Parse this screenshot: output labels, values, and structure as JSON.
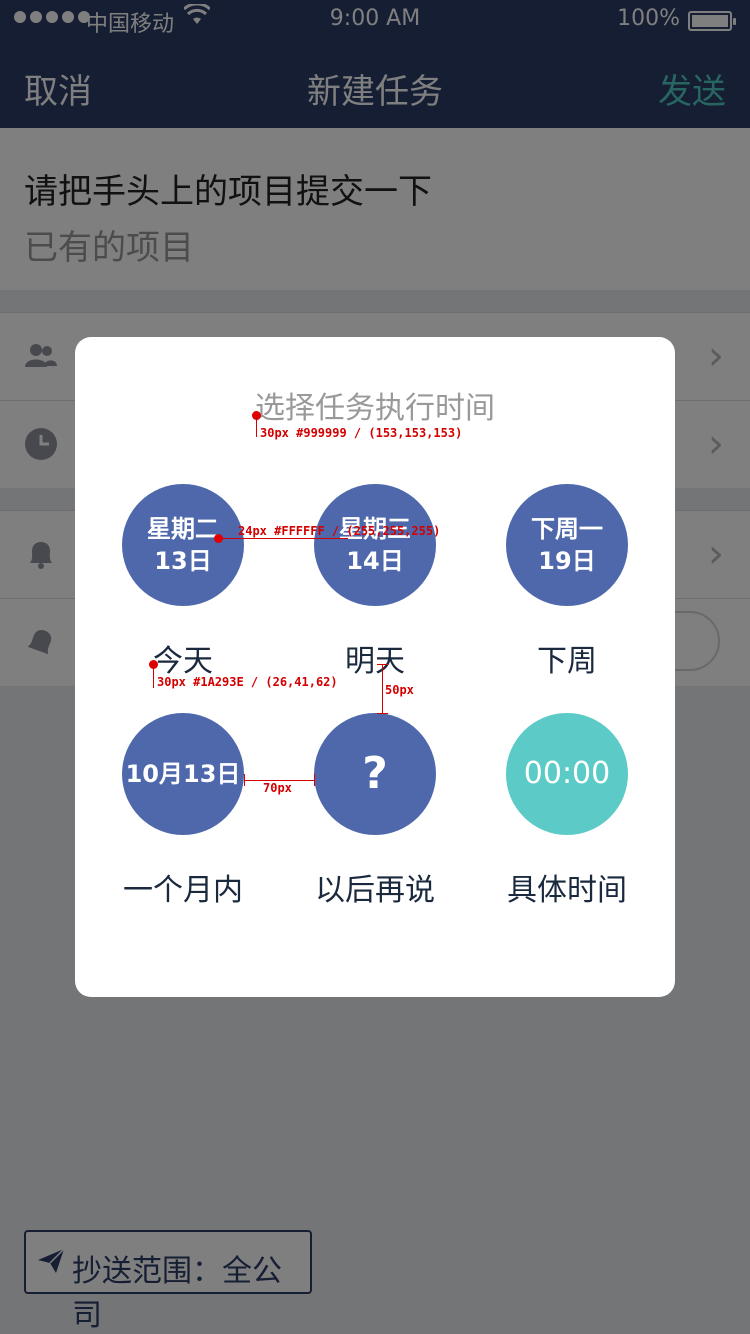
{
  "status_bar": {
    "carrier": "中国移动",
    "time": "9:00 AM",
    "battery": "100%"
  },
  "nav": {
    "cancel": "取消",
    "title": "新建任务",
    "send": "发送"
  },
  "task": {
    "title": "请把手头上的项目提交一下",
    "subtitle": "已有的项目"
  },
  "cc": {
    "label": "抄送范围：全公司"
  },
  "modal": {
    "title": "选择任务执行时间",
    "options": [
      {
        "line1": "星期二",
        "line2": "13日",
        "label": "今天"
      },
      {
        "line1": "星期三",
        "line2": "14日",
        "label": "明天"
      },
      {
        "line1": "下周一",
        "line2": "19日",
        "label": "下周"
      },
      {
        "line1": "10月13日",
        "line2": "",
        "label": "一个月内"
      },
      {
        "line1": "?",
        "line2": "",
        "label": "以后再说"
      },
      {
        "line1": "00:00",
        "line2": "",
        "label": "具体时间"
      }
    ]
  },
  "annotations": {
    "title_spec": "30px #999999 / (153,153,153)",
    "circle_text_spec": "24px #FFFFFF / (255,255,255)",
    "label_spec": "30px #1A293E / (26,41,62)",
    "vertical_gap": "50px",
    "horizontal_gap": "70px"
  },
  "colors": {
    "navy": "#2a3c66",
    "circle": "#4e68ab",
    "teal": "#5ccbc7",
    "accent_send": "#4ecbc3"
  }
}
